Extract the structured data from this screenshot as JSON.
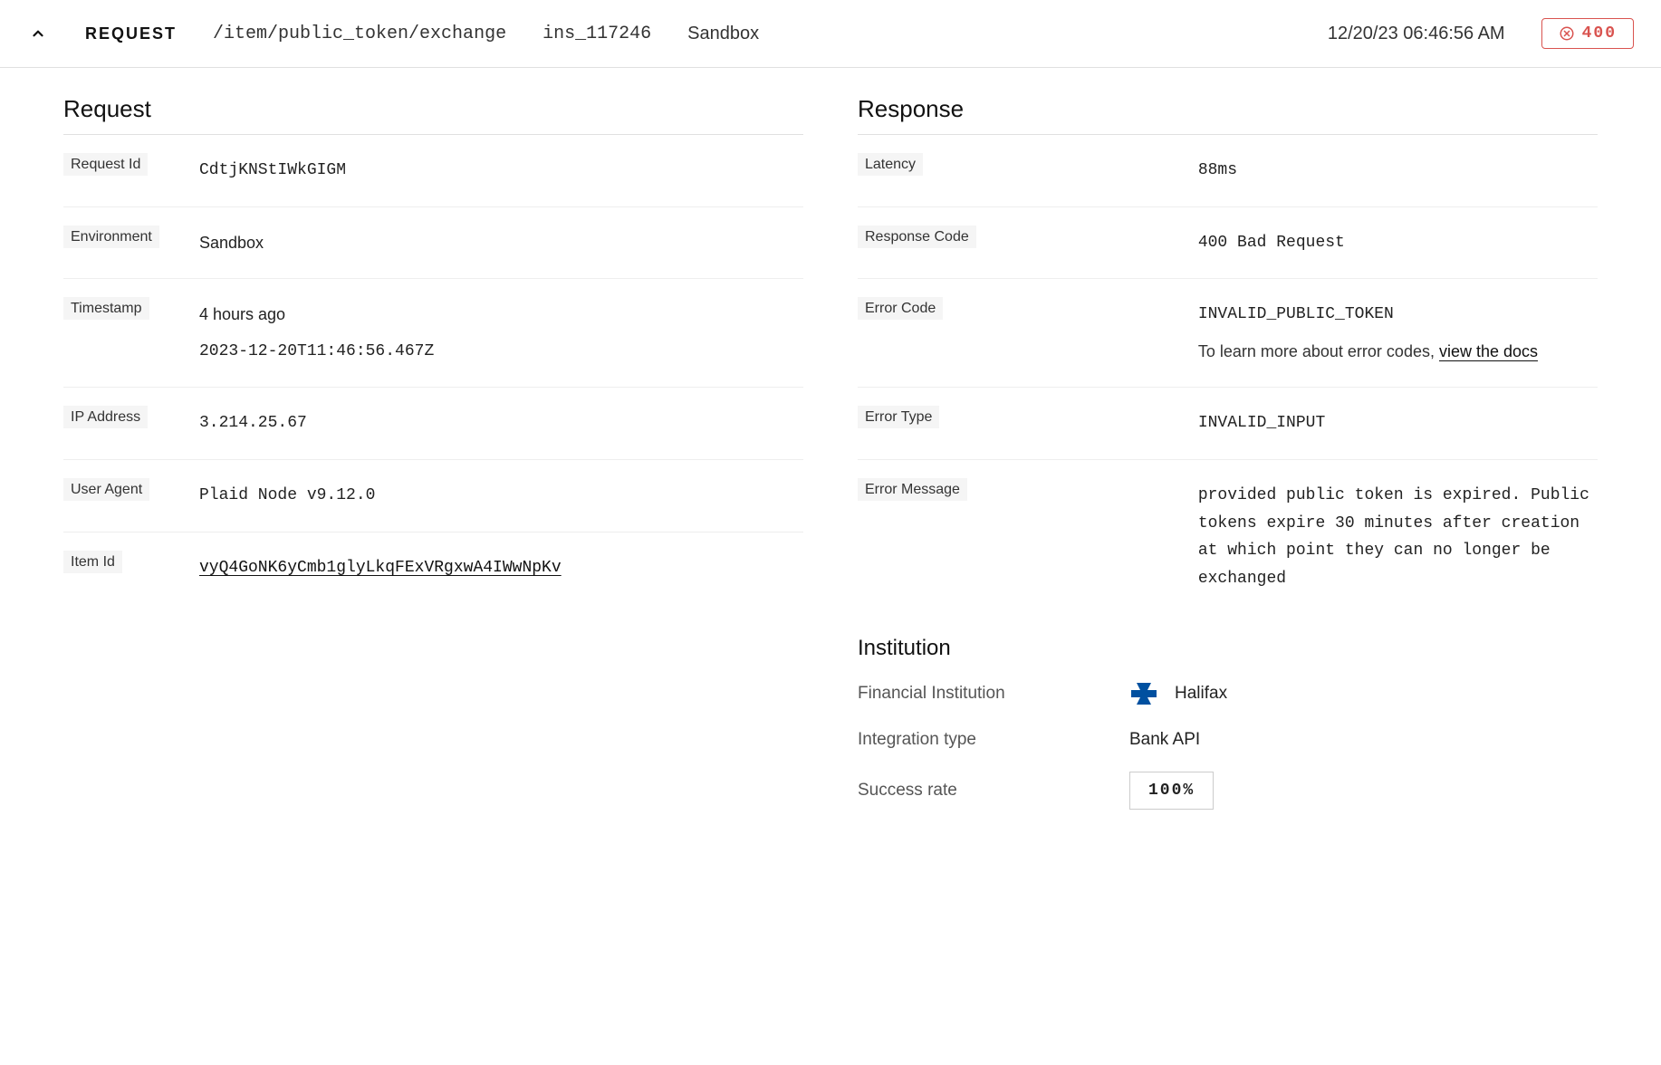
{
  "header": {
    "title": "REQUEST",
    "endpoint": "/item/public_token/exchange",
    "institution_id": "ins_117246",
    "environment": "Sandbox",
    "timestamp_display": "12/20/23 06:46:56 AM",
    "status_code": "400"
  },
  "request": {
    "title": "Request",
    "fields": {
      "request_id_label": "Request Id",
      "request_id_value": "CdtjKNStIWkGIGM",
      "environment_label": "Environment",
      "environment_value": "Sandbox",
      "timestamp_label": "Timestamp",
      "timestamp_relative": "4 hours ago",
      "timestamp_iso": "2023-12-20T11:46:56.467Z",
      "ip_label": "IP Address",
      "ip_value": "3.214.25.67",
      "user_agent_label": "User Agent",
      "user_agent_value": "Plaid Node v9.12.0",
      "item_id_label": "Item Id",
      "item_id_value": "vyQ4GoNK6yCmb1glyLkqFExVRgxwA4IWwNpKv"
    }
  },
  "response": {
    "title": "Response",
    "fields": {
      "latency_label": "Latency",
      "latency_value": "88ms",
      "response_code_label": "Response Code",
      "response_code_value": "400 Bad Request",
      "error_code_label": "Error Code",
      "error_code_value": "INVALID_PUBLIC_TOKEN",
      "error_code_help_prefix": "To learn more about error codes, ",
      "error_code_help_link": "view the docs",
      "error_type_label": "Error Type",
      "error_type_value": "INVALID_INPUT",
      "error_message_label": "Error Message",
      "error_message_value": "provided public token is expired. Public tokens expire 30 minutes after creation at which point they can no longer be exchanged"
    }
  },
  "institution": {
    "title": "Institution",
    "fi_label": "Financial Institution",
    "fi_name": "Halifax",
    "integration_label": "Integration type",
    "integration_value": "Bank API",
    "success_label": "Success rate",
    "success_value": "100%"
  }
}
